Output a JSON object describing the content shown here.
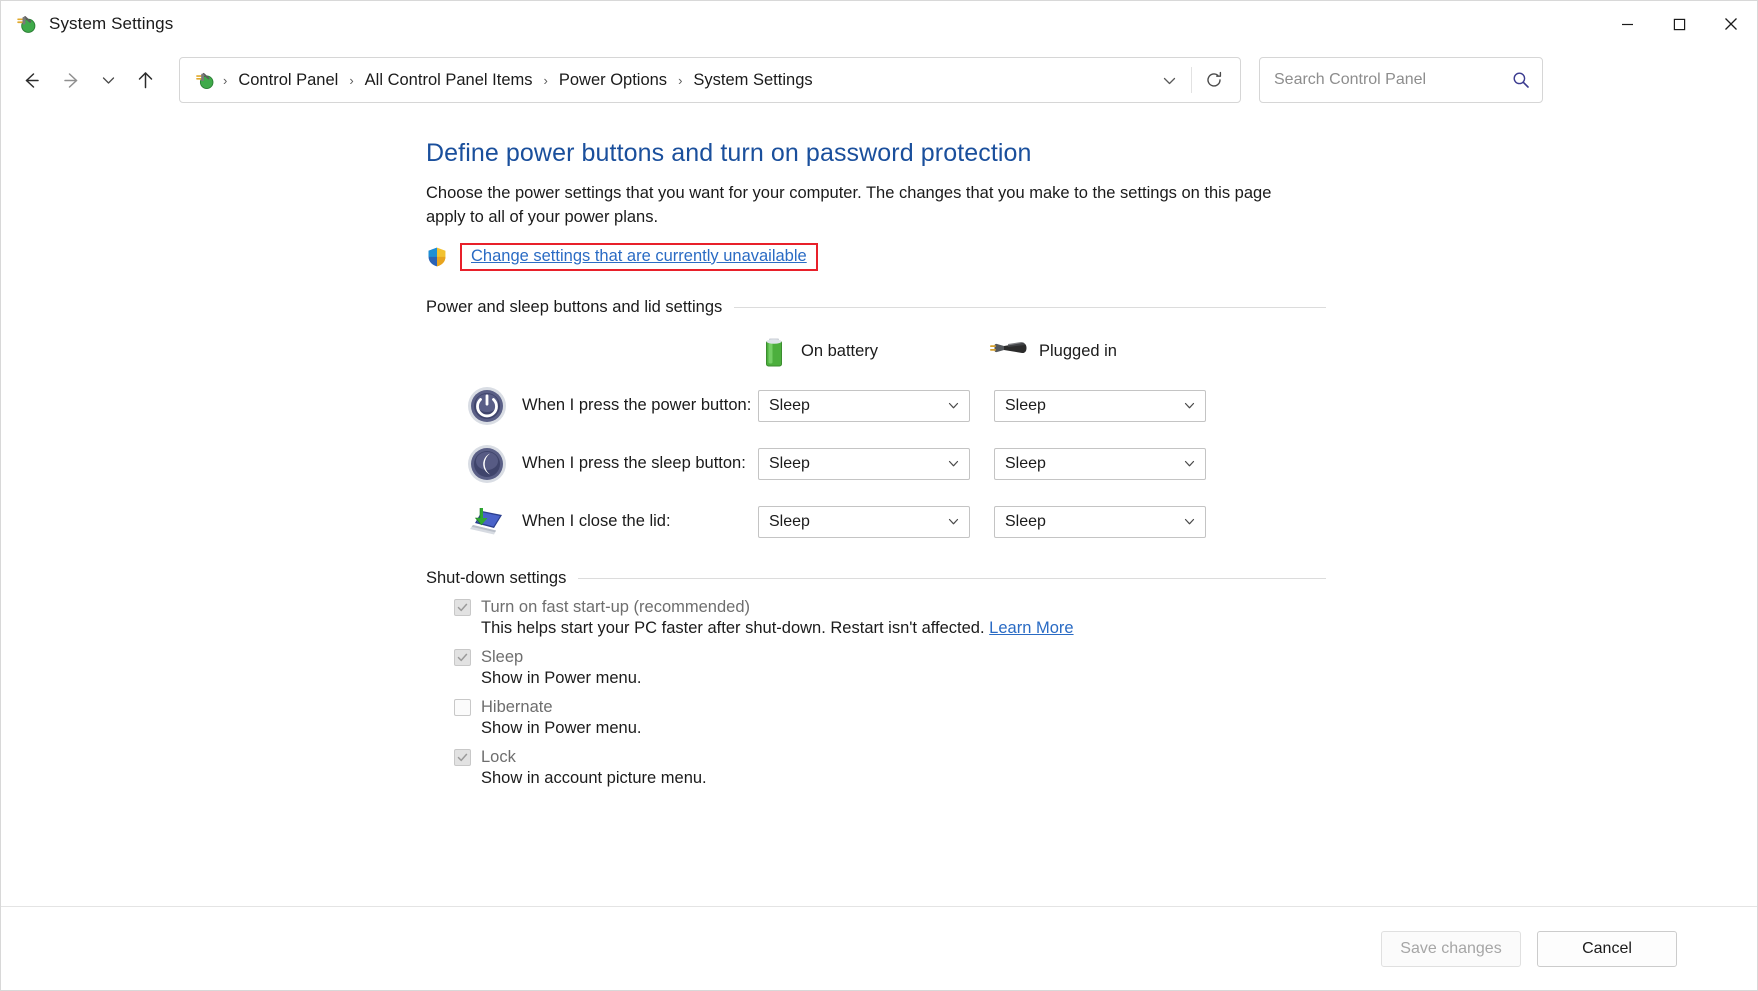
{
  "window": {
    "title": "System Settings",
    "title_icon": "power-plug-icon",
    "caption": {
      "minimize": "minimize-icon",
      "maximize": "maximize-icon",
      "close": "close-icon"
    }
  },
  "toolbar": {
    "back": "back-arrow-icon",
    "forward": "forward-arrow-icon",
    "recent": "chevron-down-icon",
    "up": "up-arrow-icon",
    "breadcrumb_icon": "power-plug-icon",
    "breadcrumbs": [
      "Control Panel",
      "All Control Panel Items",
      "Power Options",
      "System Settings"
    ],
    "separator": "›",
    "dropdown": "chevron-down-icon",
    "refresh": "refresh-icon"
  },
  "search": {
    "placeholder": "Search Control Panel",
    "icon": "search-icon"
  },
  "page": {
    "title": "Define power buttons and turn on password protection",
    "description": "Choose the power settings that you want for your computer. The changes that you make to the settings on this page apply to all of your power plans.",
    "uac": {
      "icon": "uac-shield-icon",
      "link": "Change settings that are currently unavailable",
      "highlight_color": "#e8202a"
    }
  },
  "power_section": {
    "heading": "Power and sleep buttons and lid settings",
    "columns": [
      {
        "label": "On battery",
        "icon": "battery-icon"
      },
      {
        "label": "Plugged in",
        "icon": "power-plug-icon"
      }
    ],
    "rows": [
      {
        "icon": "power-button-icon",
        "label": "When I press the power button:",
        "on_battery": "Sleep",
        "plugged_in": "Sleep"
      },
      {
        "icon": "sleep-button-icon",
        "label": "When I press the sleep button:",
        "on_battery": "Sleep",
        "plugged_in": "Sleep"
      },
      {
        "icon": "laptop-lid-icon",
        "label": "When I close the lid:",
        "on_battery": "Sleep",
        "plugged_in": "Sleep"
      }
    ]
  },
  "shutdown_section": {
    "heading": "Shut-down settings",
    "items": [
      {
        "label": "Turn on fast start-up (recommended)",
        "checked": true,
        "sub": "This helps start your PC faster after shut-down. Restart isn't affected.",
        "link": "Learn More"
      },
      {
        "label": "Sleep",
        "checked": true,
        "sub": "Show in Power menu.",
        "link": ""
      },
      {
        "label": "Hibernate",
        "checked": false,
        "sub": "Show in Power menu.",
        "link": ""
      },
      {
        "label": "Lock",
        "checked": true,
        "sub": "Show in account picture menu.",
        "link": ""
      }
    ]
  },
  "footer": {
    "save": "Save changes",
    "cancel": "Cancel"
  },
  "colors": {
    "heading_blue": "#1a4f9c",
    "link_blue": "#2a6bc4",
    "highlight_red": "#e8202a",
    "battery_green": "#4caf3d"
  }
}
